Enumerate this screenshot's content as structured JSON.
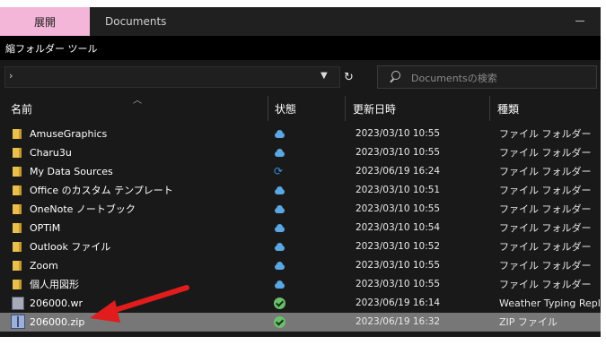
{
  "window": {
    "tab_label": "展開",
    "title": "Documents",
    "ribbon_label": "縮フォルダー ツール"
  },
  "address": {
    "chevron": "›",
    "search_placeholder": "Documentsの検索"
  },
  "columns": {
    "name": "名前",
    "status": "状態",
    "date": "更新日時",
    "type": "種類"
  },
  "rows": [
    {
      "name": "AmuseGraphics",
      "icon": "folder-icon",
      "status": "cloud-icon",
      "date": "2023/03/10 10:55",
      "type": "ファイル フォルダー"
    },
    {
      "name": "Charu3u",
      "icon": "folder-icon",
      "status": "cloud-icon",
      "date": "2023/03/10 10:55",
      "type": "ファイル フォルダー"
    },
    {
      "name": "My Data Sources",
      "icon": "folder-icon",
      "status": "sync-icon",
      "date": "2023/06/19 16:24",
      "type": "ファイル フォルダー"
    },
    {
      "name": "Office のカスタム テンプレート",
      "icon": "folder-icon",
      "status": "cloud-icon",
      "date": "2023/03/10 10:51",
      "type": "ファイル フォルダー"
    },
    {
      "name": "OneNote ノートブック",
      "icon": "folder-icon",
      "status": "cloud-icon",
      "date": "2023/03/10 10:55",
      "type": "ファイル フォルダー"
    },
    {
      "name": "OPTiM",
      "icon": "folder-icon",
      "status": "cloud-icon",
      "date": "2023/03/10 10:54",
      "type": "ファイル フォルダー"
    },
    {
      "name": "Outlook ファイル",
      "icon": "folder-icon",
      "status": "cloud-icon",
      "date": "2023/03/10 10:52",
      "type": "ファイル フォルダー"
    },
    {
      "name": "Zoom",
      "icon": "folder-icon",
      "status": "cloud-icon",
      "date": "2023/03/10 10:55",
      "type": "ファイル フォルダー"
    },
    {
      "name": "個人用図形",
      "icon": "folder-icon",
      "status": "cloud-icon",
      "date": "2023/03/10 10:55",
      "type": "ファイル フォルダー"
    },
    {
      "name": "206000.wr",
      "icon": "file-icon",
      "status": "check-icon",
      "date": "2023/06/19 16:14",
      "type": "Weather Typing Replay"
    },
    {
      "name": "206000.zip",
      "icon": "zip-icon",
      "status": "check-icon",
      "date": "2023/06/19 16:32",
      "type": "ZIP ファイル",
      "selected": true
    }
  ],
  "colors": {
    "tab_accent": "#f4b6d8",
    "selection": "#777777",
    "folder": "#e9c04f",
    "cloud": "#5aa7e3",
    "check": "#6ac06a",
    "arrow": "#e11c1c"
  }
}
